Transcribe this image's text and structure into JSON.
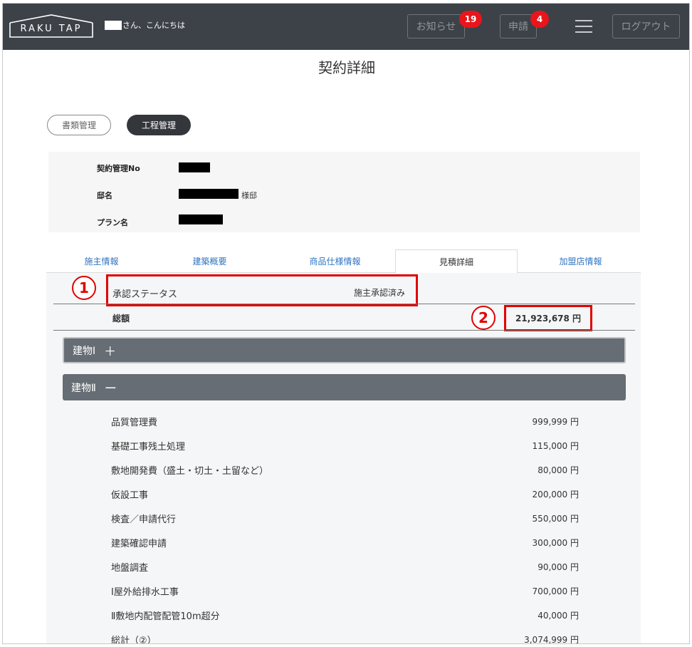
{
  "header": {
    "logo_text": "RAKU TAP",
    "greeting": "さん、こんにちは",
    "notice_label": "お知らせ",
    "notice_count": "19",
    "apply_label": "申請",
    "apply_count": "4",
    "logout_label": "ログアウト",
    "background_color": "#3d4249",
    "badge_color": "#e8151b"
  },
  "page": {
    "title": "契約詳細"
  },
  "mode_tabs": [
    {
      "label": "書類管理",
      "active": false
    },
    {
      "label": "工程管理",
      "active": true
    }
  ],
  "contract_info": {
    "contract_no_label": "契約管理No",
    "house_name_label": "邸名",
    "house_name_suffix": "様邸",
    "plan_name_label": "プラン名"
  },
  "tabs": [
    {
      "label": "施主情報",
      "active": false
    },
    {
      "label": "建築概要",
      "active": false
    },
    {
      "label": "商品仕様情報",
      "active": false
    },
    {
      "label": "見積詳細",
      "active": true
    },
    {
      "label": "加盟店情報",
      "active": false
    }
  ],
  "estimate": {
    "status_label": "承認ステータス",
    "status_value": "施主承認済み",
    "total_label": "総額",
    "total_value": "21,923,678 円",
    "annotation_1": "1",
    "annotation_2": "2",
    "annotation_color": "#e00000"
  },
  "buildings": [
    {
      "label": "建物Ⅰ",
      "toggle": "＋",
      "expanded": false
    },
    {
      "label": "建物Ⅱ",
      "toggle": "ー",
      "expanded": true
    }
  ],
  "items": [
    {
      "name": "品質管理費",
      "amount": "999,999 円"
    },
    {
      "name": "基礎工事残土処理",
      "amount": "115,000 円"
    },
    {
      "name": "敷地開発費（盛土・切土・土留など）",
      "amount": "80,000 円"
    },
    {
      "name": "仮設工事",
      "amount": "200,000 円"
    },
    {
      "name": "検査／申請代行",
      "amount": "550,000 円"
    },
    {
      "name": "建築確認申請",
      "amount": "300,000 円"
    },
    {
      "name": "地盤調査",
      "amount": "90,000 円"
    },
    {
      "name": "Ⅰ屋外給排水工事",
      "amount": "700,000 円"
    },
    {
      "name": "Ⅱ敷地内配管配管10m超分",
      "amount": "40,000 円"
    },
    {
      "name": "総計（②）",
      "amount": "3,074,999 円"
    }
  ]
}
